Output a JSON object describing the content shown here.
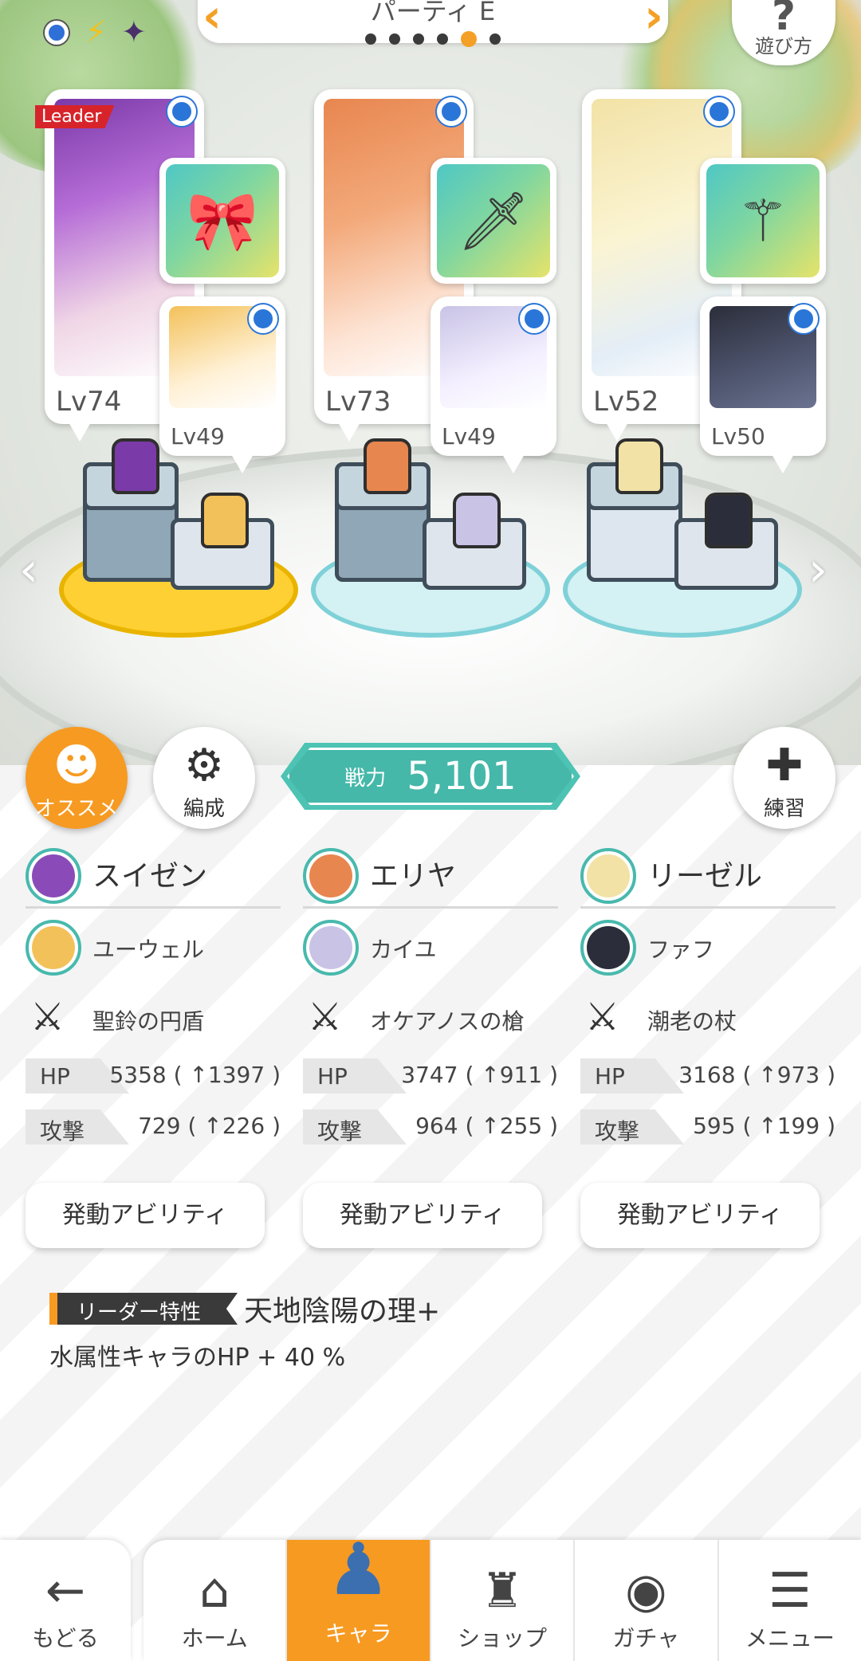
{
  "party": {
    "title": "パーティ E",
    "dots": 6,
    "active_index": 4
  },
  "help": {
    "icon": "?",
    "label": "遊び方"
  },
  "cards": [
    {
      "lv": "Lv74",
      "sub_lv": "Lv49",
      "leader": "Leader",
      "equip_icon": "🎀",
      "colors": [
        "#7a3aa8",
        "#f0d6e6"
      ],
      "sub_colors": [
        "#f3c15a",
        "#fff1d6"
      ]
    },
    {
      "lv": "Lv73",
      "sub_lv": "Lv49",
      "equip_icon": "🗡",
      "colors": [
        "#e8864f",
        "#fde3d3"
      ],
      "sub_colors": [
        "#c9c3e6",
        "#f4f0ff"
      ]
    },
    {
      "lv": "Lv52",
      "sub_lv": "Lv50",
      "equip_icon": "⚚",
      "colors": [
        "#f2e2a6",
        "#fbfbf2"
      ],
      "sub_colors": [
        "#2b2e3a",
        "#6b7391"
      ]
    }
  ],
  "actions": {
    "recommend": {
      "icon": "☻",
      "label": "オススメ"
    },
    "formation": {
      "icon": "⚙",
      "label": "編成"
    },
    "practice": {
      "icon": "✚",
      "label": "練習"
    }
  },
  "power": {
    "label": "戦力",
    "value": "5,101"
  },
  "columns": [
    {
      "main": "スイゼン",
      "sub": "ユーウェル",
      "equip": "聖鈴の円盾",
      "hp_label": "HP",
      "hp": "5358 ( ↑1397 )",
      "atk_label": "攻撃",
      "atk": "729 ( ↑226 )",
      "ability": "発動アビリティ",
      "main_face": "#8a4bb8",
      "sub_face": "#f3c15a"
    },
    {
      "main": "エリヤ",
      "sub": "カイユ",
      "equip": "オケアノスの槍",
      "hp_label": "HP",
      "hp": "3747 ( ↑911 )",
      "atk_label": "攻撃",
      "atk": "964 ( ↑255 )",
      "ability": "発動アビリティ",
      "main_face": "#e8864f",
      "sub_face": "#c9c3e6"
    },
    {
      "main": "リーゼル",
      "sub": "ファフ",
      "equip": "潮老の杖",
      "hp_label": "HP",
      "hp": "3168 ( ↑973 )",
      "atk_label": "攻撃",
      "atk": "595 ( ↑199 )",
      "ability": "発動アビリティ",
      "main_face": "#f2e2a6",
      "sub_face": "#2b2e3a"
    }
  ],
  "leader_skill": {
    "tag": "リーダー特性",
    "name": "天地陰陽の理+",
    "desc": "水属性キャラのHP + 40 %"
  },
  "nav": {
    "back": {
      "icon": "←",
      "label": "もどる"
    },
    "tabs": [
      {
        "icon": "⌂",
        "label": "ホーム"
      },
      {
        "icon": "♟",
        "label": "キャラ"
      },
      {
        "icon": "♜",
        "label": "ショップ"
      },
      {
        "icon": "◉",
        "label": "ガチャ"
      },
      {
        "icon": "☰",
        "label": "メニュー"
      }
    ]
  },
  "colors": {
    "accent": "#f79a21",
    "teal": "#45b8a9",
    "select": "#2a76d8",
    "leader": "#d7242a"
  }
}
